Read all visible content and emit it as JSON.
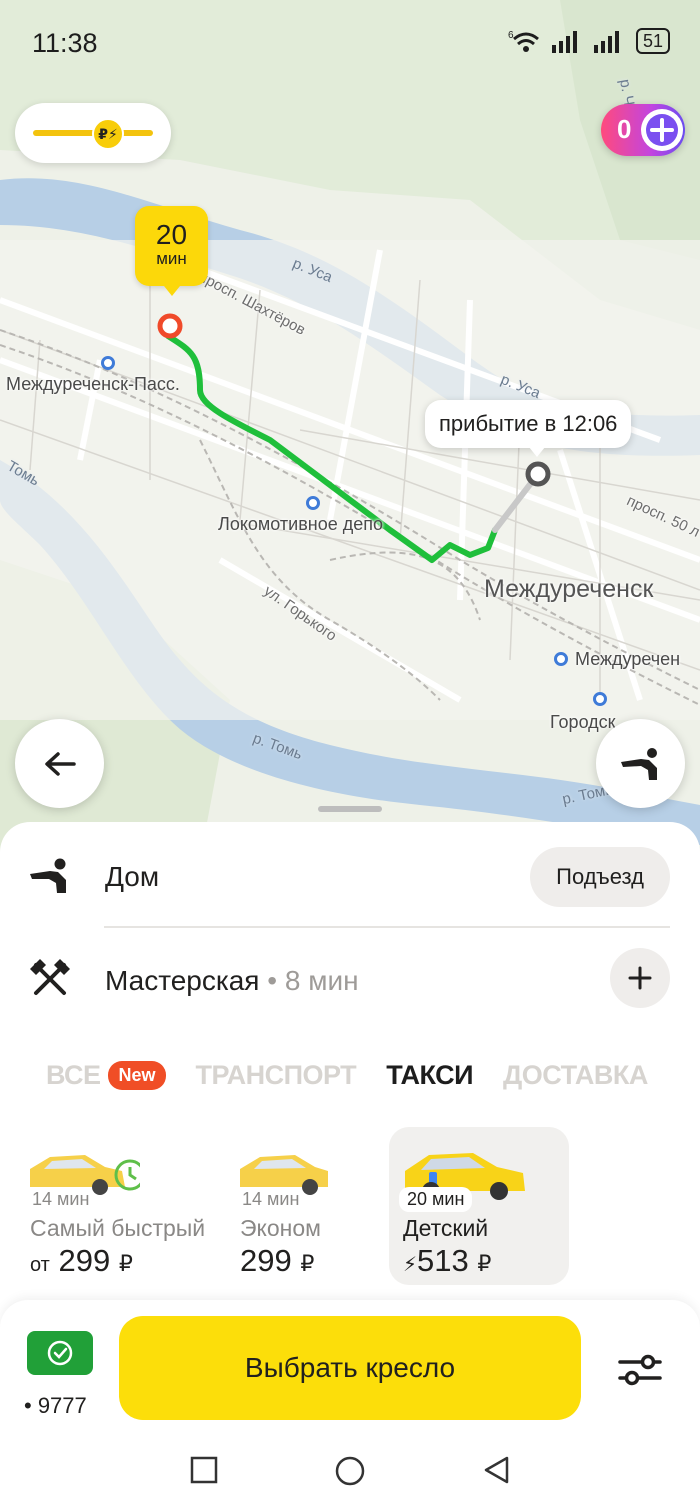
{
  "status_bar": {
    "time": "11:38",
    "network": "6",
    "battery": "51"
  },
  "map": {
    "eta_bubble": {
      "value": "20",
      "unit": "мин"
    },
    "arrival_label": "прибытие в 12:06",
    "labels": {
      "station_mezhdurechensk_pass": "Междуреченск-Пасс.",
      "lokomotive_depot": "Локомотивное депо",
      "city": "Междуреченск",
      "station_mezhdurechensk": "Междуречен",
      "gorodskoy": "Городск",
      "street_shakhterov": "просп. Шахтёров",
      "street_gorkogo": "ул. Горького",
      "street_50let": "просп. 50 л",
      "river_usa_1": "р. Уса",
      "river_usa_2": "р. Уса",
      "river_tom_1": "Томь",
      "river_tom_2": "р. Томь",
      "river_tom_3": "р. Томь",
      "river_cheras": "р. Черас"
    },
    "plus_points": "0",
    "surge_icon": "₽⚡"
  },
  "route": {
    "origin": {
      "title": "Дом",
      "entrance_button": "Подъезд"
    },
    "destination": {
      "title": "Мастерская",
      "separator": " • ",
      "duration": "8 мин"
    }
  },
  "tabs": [
    {
      "label": "ВСЕ",
      "badge": "New"
    },
    {
      "label": "ТРАНСПОРТ"
    },
    {
      "label": "ТАКСИ"
    },
    {
      "label": "ДОСТАВКА"
    }
  ],
  "active_tab": "ТАКСИ",
  "tariffs": [
    {
      "time": "14 мин",
      "name": "Самый быстрый",
      "price_prefix": "от",
      "price": "299",
      "currency": "₽"
    },
    {
      "time": "14 мин",
      "name": "Эконом",
      "price_prefix": "",
      "price": "299",
      "currency": "₽"
    },
    {
      "time": "20 мин",
      "name": "Детский",
      "price_prefix": "⚡",
      "price": "513",
      "currency": "₽",
      "selected": true
    }
  ],
  "payment": {
    "card_last": "• 9777"
  },
  "main_button": "Выбрать кресло",
  "colors": {
    "accent_yellow": "#fcde0a",
    "route_green": "#1fbf3b",
    "origin_red": "#f04a2a",
    "new_badge": "#f04e26",
    "sber_green": "#21a038"
  }
}
